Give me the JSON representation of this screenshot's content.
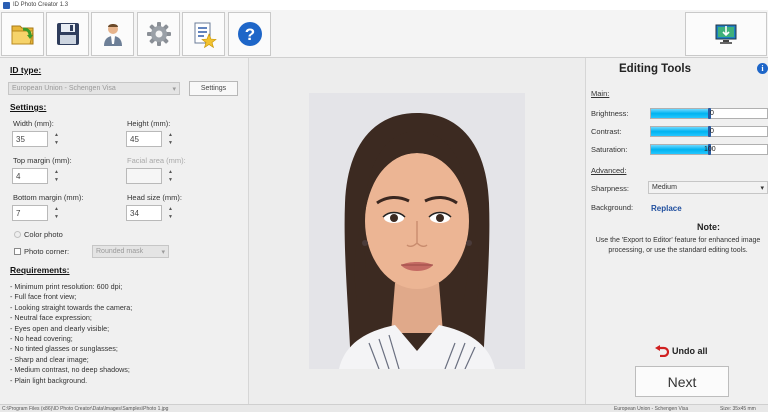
{
  "titlebar": {
    "title": "ID Photo Creator 1.3"
  },
  "toolbar": {
    "buttons": [
      "open-photo",
      "save-photo",
      "select-person",
      "settings",
      "export-to-editor",
      "help"
    ]
  },
  "left": {
    "id_type_header": "ID type:",
    "id_type_value": "European Union - Schengen Visa",
    "settings_button": "Settings",
    "settings_header": "Settings:",
    "width_label": "Width (mm):",
    "width_value": "35",
    "height_label": "Height (mm):",
    "height_value": "45",
    "top_margin_label": "Top margin (mm):",
    "top_margin_value": "4",
    "facial_area_label": "Facial area (mm):",
    "facial_area_value": "",
    "bottom_margin_label": "Bottom margin (mm):",
    "bottom_margin_value": "7",
    "head_size_label": "Head size (mm):",
    "head_size_value": "34",
    "color_photo_label": "Color photo",
    "photo_corner_label": "Photo corner:",
    "photo_corner_value": "Rounded mask",
    "requirements_header": "Requirements:",
    "requirements": [
      "- Minimum print resolution: 600 dpi;",
      "- Full face front view;",
      "- Looking straight towards the camera;",
      "- Neutral face expression;",
      "- Eyes open and clearly visible;",
      "- No head covering;",
      "- No tinted glasses or sunglasses;",
      "- Sharp and clear image;",
      "- Medium contrast, no deep shadows;",
      "- Plain light background."
    ]
  },
  "right": {
    "title": "Editing Tools",
    "main_header": "Main:",
    "brightness_label": "Brightness:",
    "brightness_value": "0",
    "contrast_label": "Contrast:",
    "contrast_value": "0",
    "saturation_label": "Saturation:",
    "saturation_value": "100",
    "advanced_header": "Advanced:",
    "sharpness_label": "Sharpness:",
    "sharpness_value": "Medium",
    "background_label": "Background:",
    "background_link": "Replace",
    "note_title": "Note:",
    "note_text": "Use the 'Export to Editor' feature for enhanced image processing, or use the standard editing tools.",
    "undo_label": "Undo all",
    "next_label": "Next"
  },
  "status": {
    "path": "C:\\Program Files (x86)\\ID Photo Creator\\Data\\Images\\Samples\\Photo 1.jpg",
    "id_type": "European Union - Schengen Visa",
    "size": "Size: 35x45 mm"
  },
  "colors": {
    "accent": "#2a5aa0",
    "slider_fill": "#00b3f0",
    "link": "#1f4e9e",
    "undo": "#d02020"
  }
}
